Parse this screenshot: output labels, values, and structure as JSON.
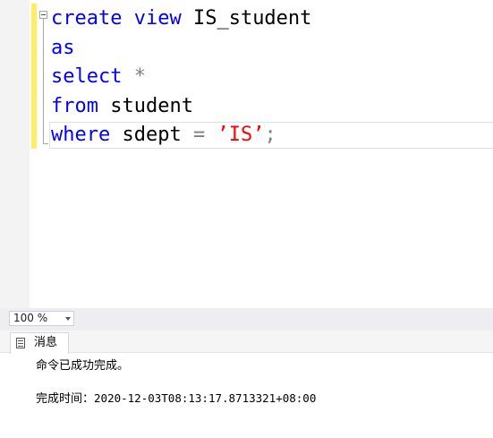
{
  "editor": {
    "lines": [
      [
        {
          "t": "create",
          "c": "kw"
        },
        {
          "t": " ",
          "c": ""
        },
        {
          "t": "view",
          "c": "kw"
        },
        {
          "t": " IS_student",
          "c": ""
        }
      ],
      [
        {
          "t": "as",
          "c": "kw"
        }
      ],
      [
        {
          "t": "select",
          "c": "kw"
        },
        {
          "t": " ",
          "c": ""
        },
        {
          "t": "*",
          "c": "gray"
        }
      ],
      [
        {
          "t": "from",
          "c": "kw"
        },
        {
          "t": " student",
          "c": ""
        }
      ],
      [
        {
          "t": "where",
          "c": "kw"
        },
        {
          "t": " sdept ",
          "c": ""
        },
        {
          "t": "=",
          "c": "gray"
        },
        {
          "t": " ",
          "c": ""
        },
        {
          "t": "’IS’",
          "c": "str"
        },
        {
          "t": ";",
          "c": "gray"
        }
      ]
    ]
  },
  "zoom": {
    "value": "100 %"
  },
  "results": {
    "tab_label": "消息",
    "message": "命令已成功完成。",
    "time_label": "完成时间：",
    "time_value": "2020-12-03T08:13:17.8713321+08:00"
  }
}
